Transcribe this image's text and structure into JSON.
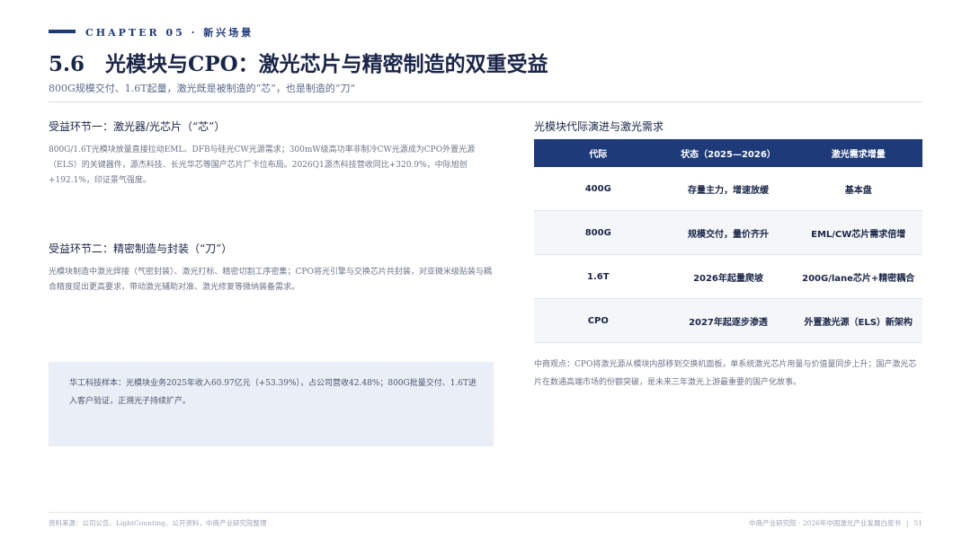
{
  "header": {
    "chapter": "CHAPTER 05 · 新兴场景",
    "title": "5.6　光模块与CPO：激光芯片与精密制造的双重受益",
    "subtitle": "800G规模交付、1.6T起量，激光既是被制造的“芯”，也是制造的“刀”"
  },
  "left": {
    "section1": {
      "heading": "受益环节一：激光器/光芯片（“芯”）",
      "body": "800G/1.6T光模块放量直接拉动EML、DFB与硅光CW光源需求；300mW级高功率非制冷CW光源成为CPO外置光源（ELS）的关键器件，源杰科技、长光华芯等国产芯片厂卡位布局。2026Q1源杰科技营收同比+320.9%，中际旭创+192.1%，印证景气强度。"
    },
    "section2": {
      "heading": "受益环节二：精密制造与封装（“刀”）",
      "body": "光模块制造中激光焊接（气密封装）、激光打标、精密切割工序密集；CPO将光引擎与交换芯片共封装，对亚微米级贴装与耦合精度提出更高要求，带动激光辅助对准、激光修复等微纳装备需求。"
    },
    "callout": "华工科技样本：光模块业务2025年收入60.97亿元（+53.39%），占公司营收42.48%；800G批量交付、1.6T进入客户验证，正溯光子持续扩产。"
  },
  "right": {
    "table_title": "光模块代际演进与激光需求",
    "table": {
      "headers": [
        "代际",
        "状态（2025—2026）",
        "激光需求增量"
      ],
      "rows": [
        [
          "400G",
          "存量主力，增速放缓",
          "基本盘"
        ],
        [
          "800G",
          "规模交付，量价齐升",
          "EML/CW芯片需求倍增"
        ],
        [
          "1.6T",
          "2026年起量爬坡",
          "200G/lane芯片+精密耦合"
        ],
        [
          "CPO",
          "2027年起逐步渗透",
          "外置激光源（ELS）新架构"
        ]
      ]
    },
    "note": "中商观点：CPO将激光源从模块内部移到交换机面板，单系统激光芯片用量与价值量同步上升；国产激光芯片在数通高端市场的份额突破，是未来三年激光上游最重要的国产化故事。"
  },
  "footer": {
    "source": "资料来源：公司公告、LightCounting、公开资料，中商产业研究院整理",
    "publisher": "中商产业研究院 · 2026年中国激光产业发展白皮书",
    "divider": "|",
    "page": "51"
  },
  "colors": {
    "accent": "#1e3a78",
    "callout_bg": "#eaeef6",
    "muted_text": "#6b7488"
  }
}
